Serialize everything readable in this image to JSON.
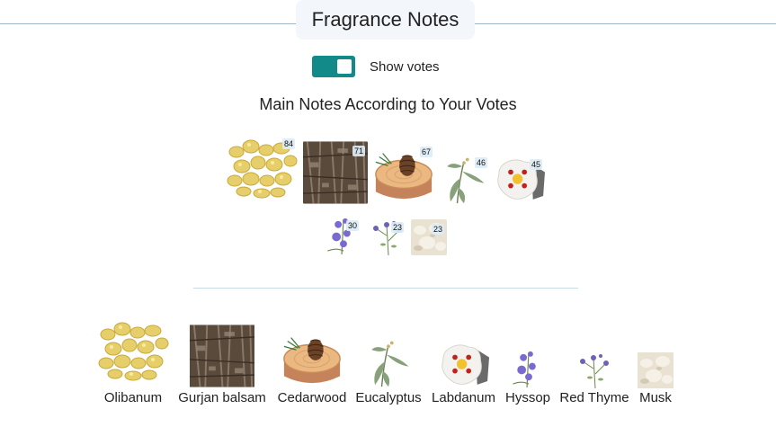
{
  "header": {
    "title": "Fragrance Notes"
  },
  "toggle": {
    "label": "Show votes",
    "checked": true
  },
  "main_notes": {
    "heading": "Main Notes According to Your Votes",
    "items": [
      {
        "name": "Olibanum",
        "votes": "84",
        "icon": "olibanum-image"
      },
      {
        "name": "Gurjan balsam",
        "votes": "71",
        "icon": "gurjan-balsam-image"
      },
      {
        "name": "Cedarwood",
        "votes": "67",
        "icon": "cedarwood-image"
      },
      {
        "name": "Eucalyptus",
        "votes": "46",
        "icon": "eucalyptus-image"
      },
      {
        "name": "Labdanum",
        "votes": "45",
        "icon": "labdanum-image"
      },
      {
        "name": "Hyssop",
        "votes": "30",
        "icon": "hyssop-image"
      },
      {
        "name": "Red Thyme",
        "votes": "23",
        "icon": "red-thyme-image"
      },
      {
        "name": "Musk",
        "votes": "23",
        "icon": "musk-image"
      }
    ]
  },
  "notes": {
    "items": [
      {
        "label": "Olibanum"
      },
      {
        "label": "Gurjan balsam"
      },
      {
        "label": "Cedarwood"
      },
      {
        "label": "Eucalyptus"
      },
      {
        "label": "Labdanum"
      },
      {
        "label": "Hyssop"
      },
      {
        "label": "Red Thyme"
      },
      {
        "label": "Musk"
      }
    ]
  },
  "colors": {
    "toggle_on": "#128a8a",
    "divider": "#c9dbe7",
    "title_bg": "#f3f7fb"
  }
}
